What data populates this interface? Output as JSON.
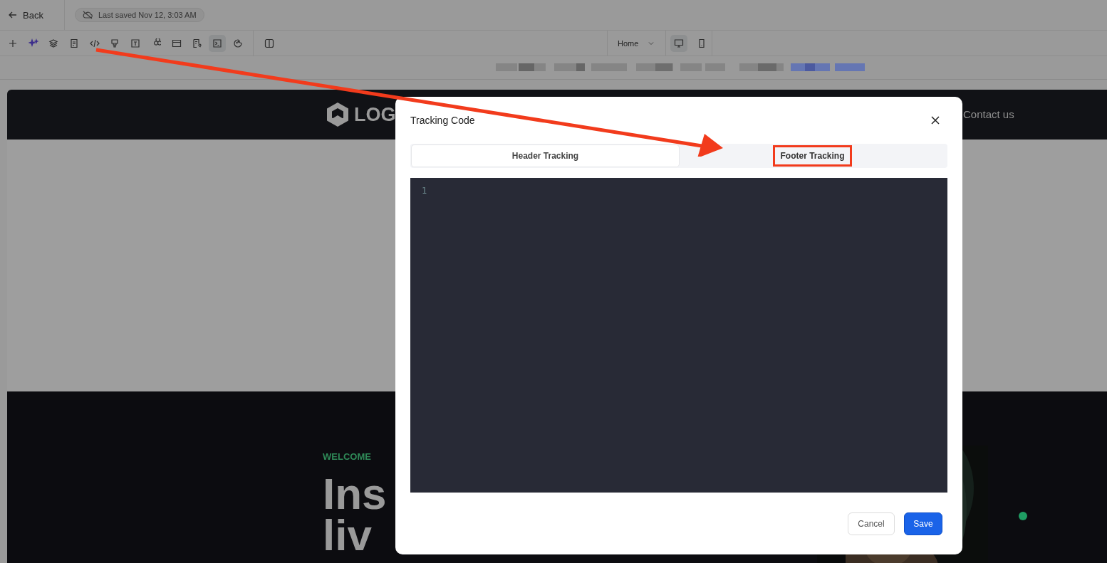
{
  "topbar": {
    "back": "Back",
    "save_status": "Last saved Nov 12, 3:03 AM"
  },
  "toolbar": [
    {
      "selected": false
    },
    {
      "selected": false
    },
    {
      "selected": false
    },
    {
      "selected": false
    },
    {
      "selected": false
    },
    {
      "selected": false
    },
    {
      "selected": false
    },
    {
      "selected": false
    },
    {
      "selected": false
    },
    {
      "selected": false
    },
    {
      "selected": true
    },
    {
      "selected": false
    }
  ],
  "page_select": {
    "value": "Home"
  },
  "devices": [
    {
      "selected": true
    },
    {
      "selected": false
    }
  ],
  "site": {
    "logo": "LOG",
    "nav": "Contact us",
    "eyebrow": "WELCOME",
    "headline": [
      "Ins",
      "liv"
    ]
  },
  "dialog": {
    "title": "Tracking Code",
    "tabs": [
      {
        "label": "Header Tracking",
        "selected": true
      },
      {
        "label": "Footer Tracking",
        "selected": false
      }
    ],
    "editor": {
      "line_numbers": [
        "1"
      ]
    },
    "buttons": [
      {
        "label": "Cancel",
        "kind": "secondary"
      },
      {
        "label": "Save",
        "kind": "primary"
      }
    ]
  }
}
